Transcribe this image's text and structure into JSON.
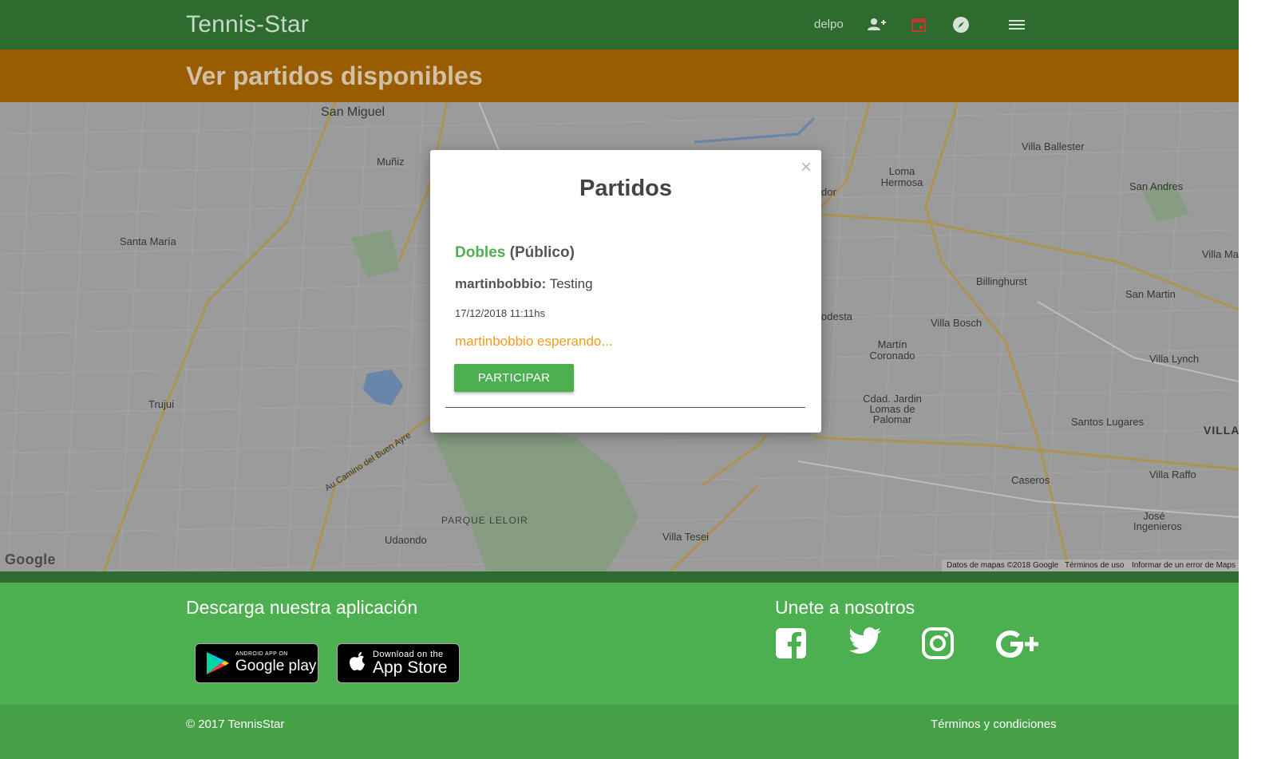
{
  "navbar": {
    "brand": "Tennis-Star",
    "username": "delpo",
    "icons": [
      "people-icon",
      "calendar-icon",
      "compass-icon",
      "menu-icon"
    ]
  },
  "header": {
    "title": "Ver partidos disponibles"
  },
  "map": {
    "labels": [
      "San Miguel",
      "Muñiz",
      "Santa María",
      "Trujui",
      "Udaondo",
      "PARQUE LELOIR",
      "Villa Tesei",
      "Loma Hermosa",
      "Villa Ballester",
      "San Andres",
      "Villa Ma",
      "Billinghurst",
      "San Martin",
      "Villa Bosch",
      "Martín Coronado",
      "Villa Lynch",
      "Cdad. Jardin Lomas de Palomar",
      "Santos Lugares",
      "Caseros",
      "Villa Raffo",
      "José Ingenieros",
      "VILLA",
      "odesta",
      "dor",
      "Au Camino del Buen Ayre"
    ],
    "google_logo": "Google",
    "attribution": "Datos de mapas ©2018 Google",
    "terms": "Términos de uso",
    "report": "Informar de un error de Maps"
  },
  "modal": {
    "title": "Partidos",
    "close_glyph": "×",
    "match": {
      "type": "Dobles",
      "visibility": "(Público)",
      "owner": "martinbobbio:",
      "description": "Testing",
      "datetime": "17/12/2018 11:11hs",
      "status": "martinbobbio esperando...",
      "join_label": "PARTICIPAR"
    }
  },
  "footer": {
    "download_heading": "Descarga nuestra aplicación",
    "join_heading": "Unete a nosotros",
    "google_play": {
      "small": "ANDROID APP ON",
      "big": "Google play"
    },
    "app_store": {
      "small": "Download on the",
      "big": "App Store"
    },
    "social": [
      "facebook-icon",
      "twitter-icon",
      "instagram-icon",
      "google-plus-icon"
    ],
    "copyright": "© 2017 TennisStar",
    "terms": "Términos y condiciones"
  },
  "colors": {
    "navbar": "#2e6b2f",
    "header": "#9a5c00",
    "footer": "#4caf50",
    "accent_green": "#4caf50",
    "status_orange": "#f39a1f"
  }
}
